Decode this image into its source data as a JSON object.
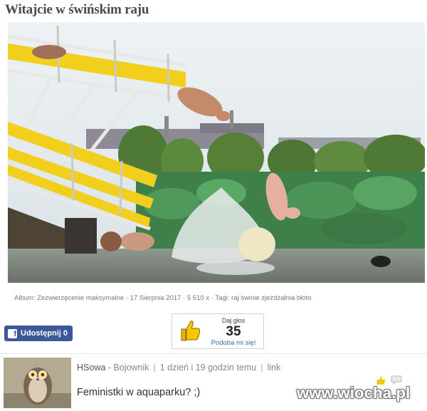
{
  "post": {
    "title": "Witajcie w świńskim raju",
    "meta": "Album: Zezwierzęcenie maksymalne · 17 Sierpnia 2017 · 5 510 x · Tagi: raj świnie zjeżdżalnia błoto"
  },
  "share": {
    "label": "Udostępnij 0",
    "icon": "facebook-icon"
  },
  "vote": {
    "label": "Daj głos",
    "count": "35",
    "like_label": "Podoba mi się!",
    "icon": "thumbs-up-icon"
  },
  "comment": {
    "author": "HSowa",
    "rank": " - Bojownik",
    "time": "1 dzień i 19 godzin temu",
    "link_label": "link",
    "text": "Feministki w aquaparku? ;)"
  },
  "watermark": "www.wiocha.pl",
  "colors": {
    "facebook": "#3b5998",
    "like_link": "#2a6fbf",
    "slide": "#f2cf1c"
  }
}
